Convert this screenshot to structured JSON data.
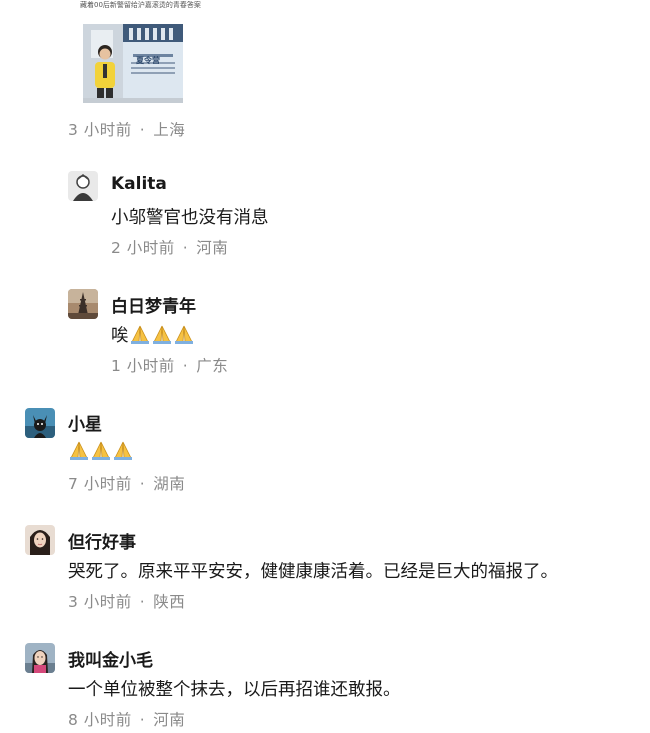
{
  "post": {
    "caption": "藏着00后新警留给沪嘉滚烫的青春答案",
    "image_text": "夏令营",
    "meta_time": "3 小时前",
    "meta_location": "上海"
  },
  "separator": "·",
  "comments": [
    {
      "username": "Kalita",
      "text": "小邬警官也没有消息",
      "time": "2 小时前",
      "location": "河南"
    },
    {
      "username": "白日梦青年",
      "text": "唉",
      "emoji": "folded-hands-emoji",
      "emoji_count": 3,
      "time": "1 小时前",
      "location": "广东"
    },
    {
      "username": "小星",
      "text": "",
      "emoji": "folded-hands-emoji",
      "emoji_count": 3,
      "time": "7 小时前",
      "location": "湖南"
    },
    {
      "username": "但行好事",
      "text": "哭死了。原来平平安安，健健康康活着。已经是巨大的福报了。",
      "time": "3 小时前",
      "location": "陕西"
    },
    {
      "username": "我叫金小毛",
      "text": "一个单位被整个抹去，以后再招谁还敢报。",
      "time": "8 小时前",
      "location": "河南"
    }
  ],
  "colors": {
    "meta_text": "#8a8a8a",
    "body_text": "#1a1a1a",
    "emoji_yellow": "#f6c243"
  }
}
